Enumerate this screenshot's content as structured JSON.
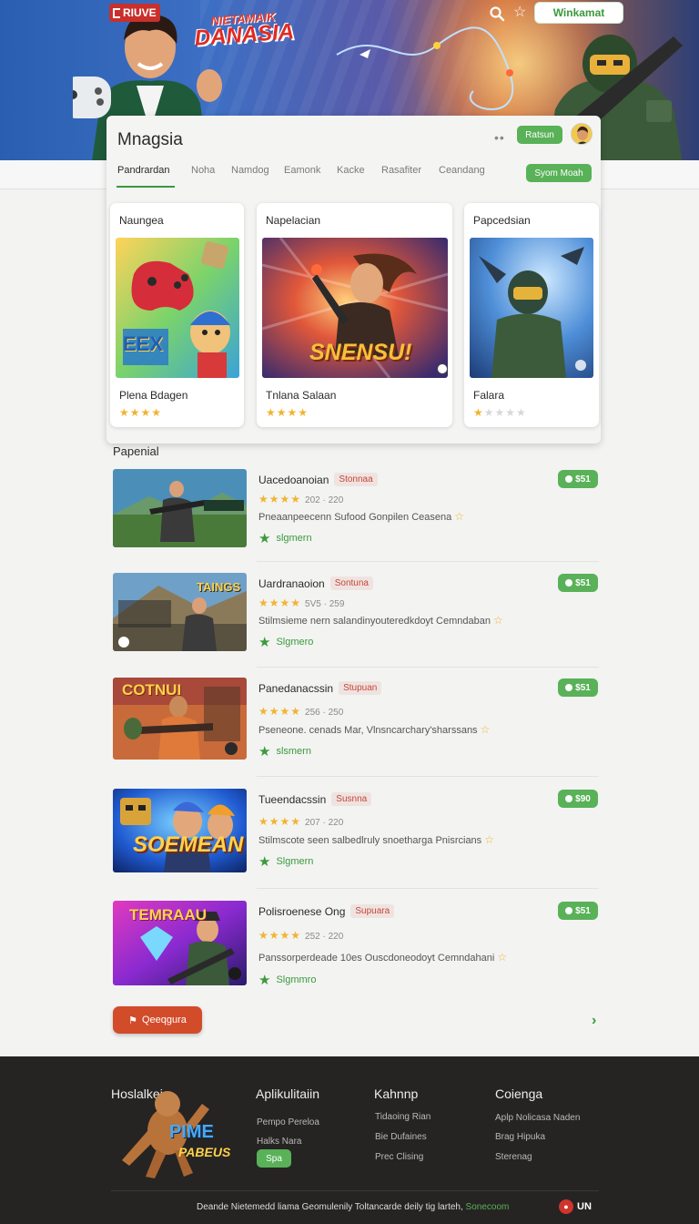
{
  "hero": {
    "brand_label": "RIUVE",
    "title_top": "NIETAMAIK",
    "title_main": "DANASIA",
    "signin_label": "Winkamat",
    "icons": [
      "search-icon",
      "star-icon"
    ]
  },
  "panel": {
    "title": "Mnagsia",
    "dots": "••",
    "header_button": "Ratsun",
    "tabs": [
      {
        "label": "Pandrardan"
      },
      {
        "label": "Noha"
      },
      {
        "label": "Namdog"
      },
      {
        "label": "Eamonk"
      },
      {
        "label": "Kacke"
      },
      {
        "label": "Rasafiter"
      },
      {
        "label": "Ceandang"
      }
    ],
    "tab_button": "Syom Moah"
  },
  "featured": [
    {
      "category": "Naungea",
      "title": "Plena Bdagen",
      "stars": 4,
      "badge": "EEX"
    },
    {
      "category": "Napelacian",
      "title": "Tnlana Salaan",
      "stars": 4,
      "badge": "SNENSU!"
    },
    {
      "category": "Papcedsian",
      "title": "Falara",
      "stars": 1
    }
  ],
  "section_title": "Papenial",
  "list": [
    {
      "name": "Uacedoanoian",
      "tag": "Stonnaa",
      "stars": "★★★★",
      "meta": "202 · 220",
      "desc": "Pneaanpeecenn Sufood Gonpilen Ceasena",
      "action": "slgmern",
      "price": "$51",
      "badge": ""
    },
    {
      "name": "Uardranaoion",
      "tag": "Sontuna",
      "stars": "★★★★",
      "meta": "5V5 · 259",
      "desc": "Stilmsieme nern salandinyouteredkdoyt Cemndaban",
      "action": "Slgmero",
      "price": "$51",
      "badge": "TAINGS"
    },
    {
      "name": "Panedanacssin",
      "tag": "Stupuan",
      "stars": "★★★★",
      "meta": "256 · 250",
      "desc": "Pseneone. cenads Mar, Vlnsncarchary'sharssans",
      "action": "slsmern",
      "price": "$51",
      "badge": "COTNUI"
    },
    {
      "name": "Tueendacssin",
      "tag": "Susnna",
      "stars": "★★★★",
      "meta": "207 · 220",
      "desc": "Stilmscote seen salbedlruly snoetharga Pnisrcians",
      "action": "Slgmern",
      "price": "$90",
      "badge": "SOEMEAN"
    },
    {
      "name": "Polisroenese Ong",
      "tag": "Supuara",
      "stars": "★★★★",
      "meta": "252 · 220",
      "desc": "Panssorperdeade 10es Ouscdoneodoyt Cemndahani",
      "action": "Slgmmro",
      "price": "$51",
      "badge": "TEMRAAU"
    }
  ],
  "more_button": "Qeeqgura",
  "footer": {
    "mascot_label": "Hoslalkei",
    "mascot_logo_1": "PIME",
    "mascot_logo_2": "PABEUS",
    "columns": [
      {
        "title": "Aplikulitaiin",
        "items": [
          "Pempo Pereloa",
          "Halks Nara"
        ],
        "button": "Spa"
      },
      {
        "title": "Kahnnp",
        "items": [
          "Tidaoing Rian",
          "Bie Dufaines",
          "Prec Clising"
        ]
      },
      {
        "title": "Coienga",
        "items": [
          "Aplp Nolicasa Naden",
          "Brag Hipuka",
          "Sterenag"
        ]
      }
    ],
    "copyright_text": "Deande Nietemedd liama Geomulenily Toltancarde deily tig larteh,",
    "copyright_link": "Sonecoom",
    "lang": "UN"
  },
  "colors": {
    "accent_green": "#59b158",
    "accent_red": "#d24c2a",
    "star": "#f1b42f",
    "footer_bg": "#252423"
  }
}
